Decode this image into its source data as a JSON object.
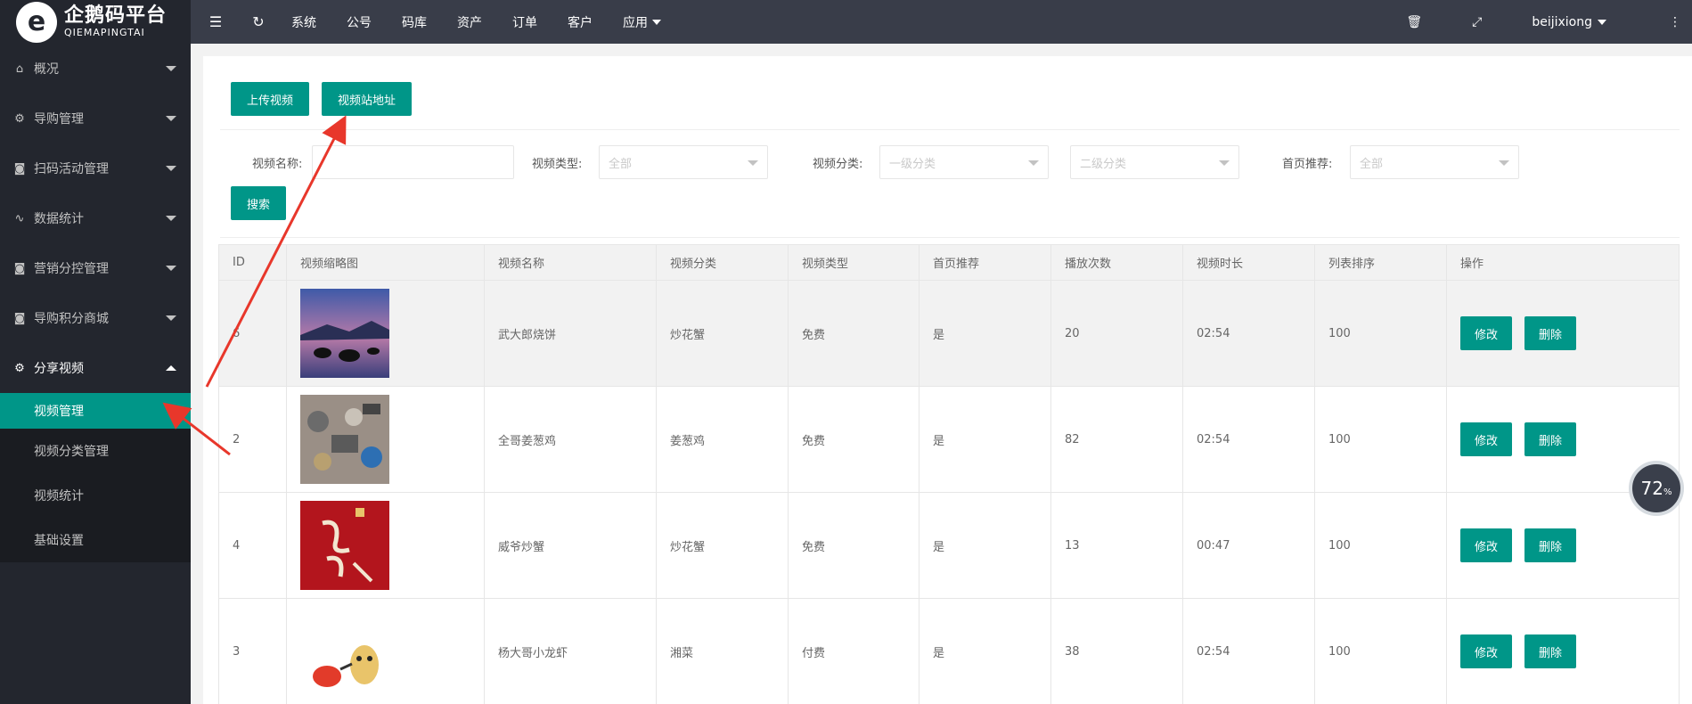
{
  "logo": {
    "cn": "企鹅码平台",
    "en": "QIEMAPINGTAI"
  },
  "header": {
    "links": [
      "系统",
      "公号",
      "码库",
      "资产",
      "订单",
      "客户",
      "应用"
    ],
    "user": "beijixiong"
  },
  "sidebar": {
    "items": [
      {
        "label": "概况",
        "icon": "home-icon"
      },
      {
        "label": "导购管理",
        "icon": "gear-icon"
      },
      {
        "label": "扫码活动管理",
        "icon": "camera-icon"
      },
      {
        "label": "数据统计",
        "icon": "pulse-icon"
      },
      {
        "label": "营销分控管理",
        "icon": "camera-icon"
      },
      {
        "label": "导购积分商城",
        "icon": "camera-icon"
      },
      {
        "label": "分享视频",
        "icon": "gear-icon"
      }
    ],
    "subitems": [
      "视频管理",
      "视频分类管理",
      "视频统计",
      "基础设置"
    ]
  },
  "buttons": {
    "upload": "上传视频",
    "site": "视频站地址",
    "search": "搜索"
  },
  "filter": {
    "name_label": "视频名称:",
    "type_label": "视频类型:",
    "type_value": "全部",
    "cat_label": "视频分类:",
    "cat1_value": "一级分类",
    "cat2_value": "二级分类",
    "rec_label": "首页推荐:",
    "rec_value": "全部"
  },
  "table": {
    "headers": [
      "ID",
      "视频缩略图",
      "视频名称",
      "视频分类",
      "视频类型",
      "首页推荐",
      "播放次数",
      "视频时长",
      "列表排序",
      "操作"
    ],
    "rows": [
      {
        "id": "6",
        "name": "武大郎烧饼",
        "cat": "炒花蟹",
        "type": "免费",
        "rec": "是",
        "plays": "20",
        "dur": "02:54",
        "sort": "100"
      },
      {
        "id": "2",
        "name": "全哥姜葱鸡",
        "cat": "姜葱鸡",
        "type": "免费",
        "rec": "是",
        "plays": "82",
        "dur": "02:54",
        "sort": "100"
      },
      {
        "id": "4",
        "name": "威爷炒蟹",
        "cat": "炒花蟹",
        "type": "免费",
        "rec": "是",
        "plays": "13",
        "dur": "00:47",
        "sort": "100"
      },
      {
        "id": "3",
        "name": "杨大哥小龙虾",
        "cat": "湘菜",
        "type": "付费",
        "rec": "是",
        "plays": "38",
        "dur": "02:54",
        "sort": "100"
      }
    ],
    "edit_label": "修改",
    "delete_label": "删除"
  },
  "badge": {
    "value": "72",
    "unit": "%"
  },
  "colors": {
    "accent": "#009688",
    "sidebar": "#23262e",
    "header": "#393d49"
  }
}
